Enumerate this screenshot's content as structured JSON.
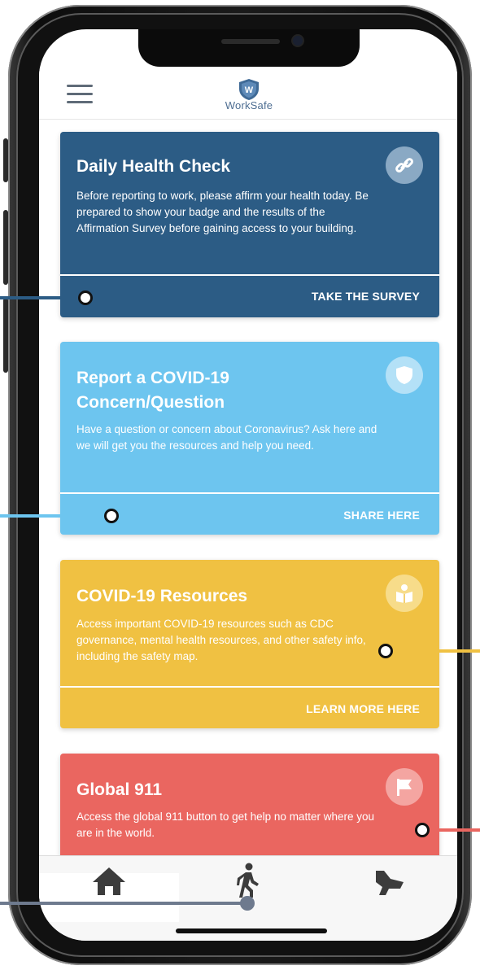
{
  "app": {
    "logo_text": "WorkSafe"
  },
  "cards": [
    {
      "title": "Daily Health Check",
      "body": "Before reporting to work, please affirm your health today.  Be prepared to show your badge and the results of the Affirmation Survey before gaining access to your building.",
      "action": "TAKE THE SURVEY",
      "color": "#2c5c85",
      "icon": "link-icon"
    },
    {
      "title": "Report a COVID-19 Concern/Question",
      "body": "Have a question or concern about Coronavirus? Ask here and we will get you the resources and help you need.",
      "action": "SHARE HERE",
      "color": "#6dc5ef",
      "icon": "shield-icon"
    },
    {
      "title": "COVID-19 Resources",
      "body": "Access important COVID-19 resources such as CDC governance, mental health resources, and other safety info, including the safety map.",
      "action": "LEARN MORE HERE",
      "color": "#f0c142",
      "icon": "book-reader-icon"
    },
    {
      "title": "Global 911",
      "body": "Access the global 911 button to get help no matter where you are in the world.",
      "action": "",
      "color": "#ea6660",
      "icon": "flag-icon"
    }
  ],
  "tabbar": {
    "items": [
      "home-icon",
      "walking-person-icon",
      "megaphone-icon"
    ]
  },
  "colors": {
    "callout_blue": "#2c5c85",
    "callout_light": "#6dc5ef",
    "callout_yellow": "#f0c142",
    "callout_red": "#ea6660",
    "callout_gray": "#6e7a8e"
  }
}
